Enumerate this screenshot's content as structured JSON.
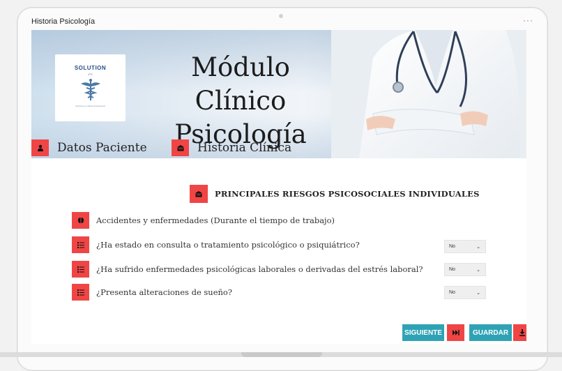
{
  "window": {
    "title": "Historia Psicología",
    "menu": "···"
  },
  "banner": {
    "logo": {
      "name": "SOLUTION",
      "sub": "IPS",
      "tagline": "Servicios en Salud Ocupacional"
    },
    "title": "Módulo Clínico\nPsicología"
  },
  "nav": {
    "items": [
      {
        "label": "Datos Paciente",
        "icon": "person-icon"
      },
      {
        "label": "Historia Clínica",
        "icon": "archive-icon"
      }
    ]
  },
  "section": {
    "title": "PRINCIPALES RIESGOS PSICOSOCIALES INDIVIDUALES",
    "icon": "archive-icon"
  },
  "questions": [
    {
      "label": "Accidentes y enfermedades (Durante el tiempo de trabajo)",
      "icon": "brain-icon"
    },
    {
      "label": "¿Ha estado en consulta o tratamiento psicológico o psiquiátrico?",
      "icon": "list-icon",
      "value": "No"
    },
    {
      "label": "¿Ha sufrido enfermedades psicológicas laborales o derivadas del estrés laboral?",
      "icon": "list-icon",
      "value": "No"
    },
    {
      "label": "¿Presenta alteraciones de sueño?",
      "icon": "list-icon",
      "value": "No"
    }
  ],
  "actions": {
    "next_label": "SIGUIENTE",
    "save_label": "GUARDAR"
  },
  "colors": {
    "accent": "#f04545",
    "button": "#2fa3b5"
  }
}
